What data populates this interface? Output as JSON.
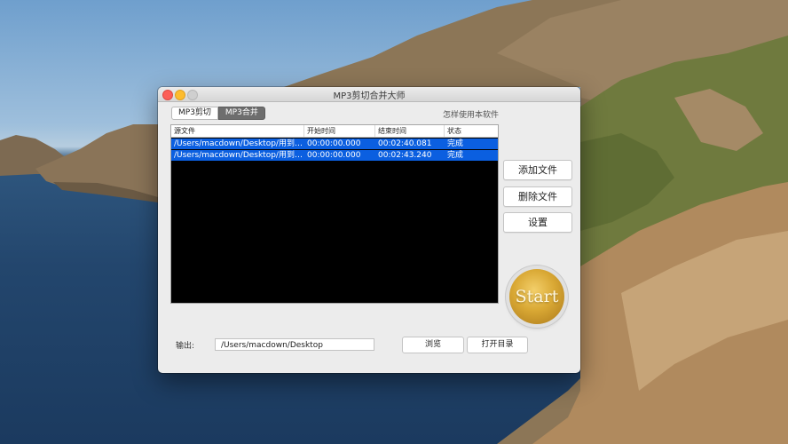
{
  "window": {
    "title": "MP3剪切合并大师"
  },
  "tabs": [
    {
      "label": "MP3剪切",
      "active": false
    },
    {
      "label": "MP3合并",
      "active": true
    }
  ],
  "help_link": "怎样使用本软件",
  "table": {
    "columns": [
      "源文件",
      "开始时间",
      "结束时间",
      "状态"
    ],
    "rows": [
      {
        "source": "/Users/macdown/Desktop/用到…",
        "start": "00:00:00.000",
        "end": "00:02:40.081",
        "status": "完成"
      },
      {
        "source": "/Users/macdown/Desktop/用到…",
        "start": "00:00:00.000",
        "end": "00:02:43.240",
        "status": "完成"
      }
    ]
  },
  "side_buttons": {
    "add": "添加文件",
    "delete": "删除文件",
    "settings": "设置"
  },
  "start_button": "Start",
  "output": {
    "label": "输出:",
    "path": "/Users/macdown/Desktop",
    "browse": "浏览",
    "open_dir": "打开目录"
  },
  "colors": {
    "selection": "#0b5fe0",
    "start_gold": "#d9a834"
  }
}
